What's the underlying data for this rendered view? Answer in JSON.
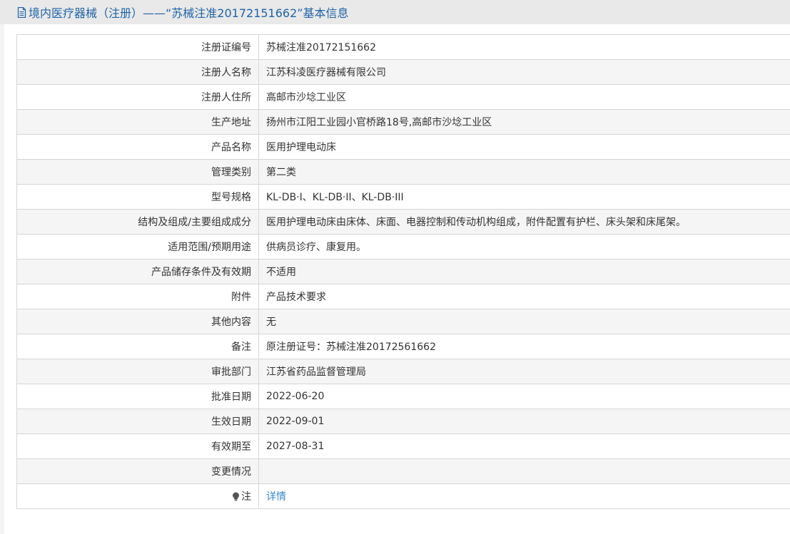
{
  "header": {
    "title": "境内医疗器械（注册）——“苏械注准20172151662”基本信息"
  },
  "rows": [
    {
      "label": "注册证编号",
      "value": "苏械注准20172151662"
    },
    {
      "label": "注册人名称",
      "value": "江苏科凌医疗器械有限公司"
    },
    {
      "label": "注册人住所",
      "value": "高邮市沙埝工业区"
    },
    {
      "label": "生产地址",
      "value": "扬州市江阳工业园小官桥路18号,高邮市沙埝工业区"
    },
    {
      "label": "产品名称",
      "value": "医用护理电动床"
    },
    {
      "label": "管理类别",
      "value": "第二类"
    },
    {
      "label": "型号规格",
      "value": "KL-DB·I、KL-DB·II、KL-DB·III"
    },
    {
      "label": "结构及组成/主要组成成分",
      "value": "医用护理电动床由床体、床面、电器控制和传动机构组成，附件配置有护栏、床头架和床尾架。"
    },
    {
      "label": "适用范围/预期用途",
      "value": "供病员诊疗、康复用。"
    },
    {
      "label": "产品储存条件及有效期",
      "value": "不适用"
    },
    {
      "label": "附件",
      "value": "产品技术要求"
    },
    {
      "label": "其他内容",
      "value": "无"
    },
    {
      "label": "备注",
      "value": "原注册证号：苏械注准20172561662"
    },
    {
      "label": "审批部门",
      "value": "江苏省药品监督管理局"
    },
    {
      "label": "批准日期",
      "value": "2022-06-20"
    },
    {
      "label": "生效日期",
      "value": "2022-09-01"
    },
    {
      "label": "有效期至",
      "value": "2027-08-31"
    },
    {
      "label": "变更情况",
      "value": ""
    }
  ],
  "note_row": {
    "icon": "lightbulb-icon",
    "label": "注",
    "link_text": "详情"
  },
  "colors": {
    "title": "#1f63a8",
    "link": "#3a86c8",
    "border": "#d6d6d6",
    "stripe": "#f5f5f5"
  }
}
